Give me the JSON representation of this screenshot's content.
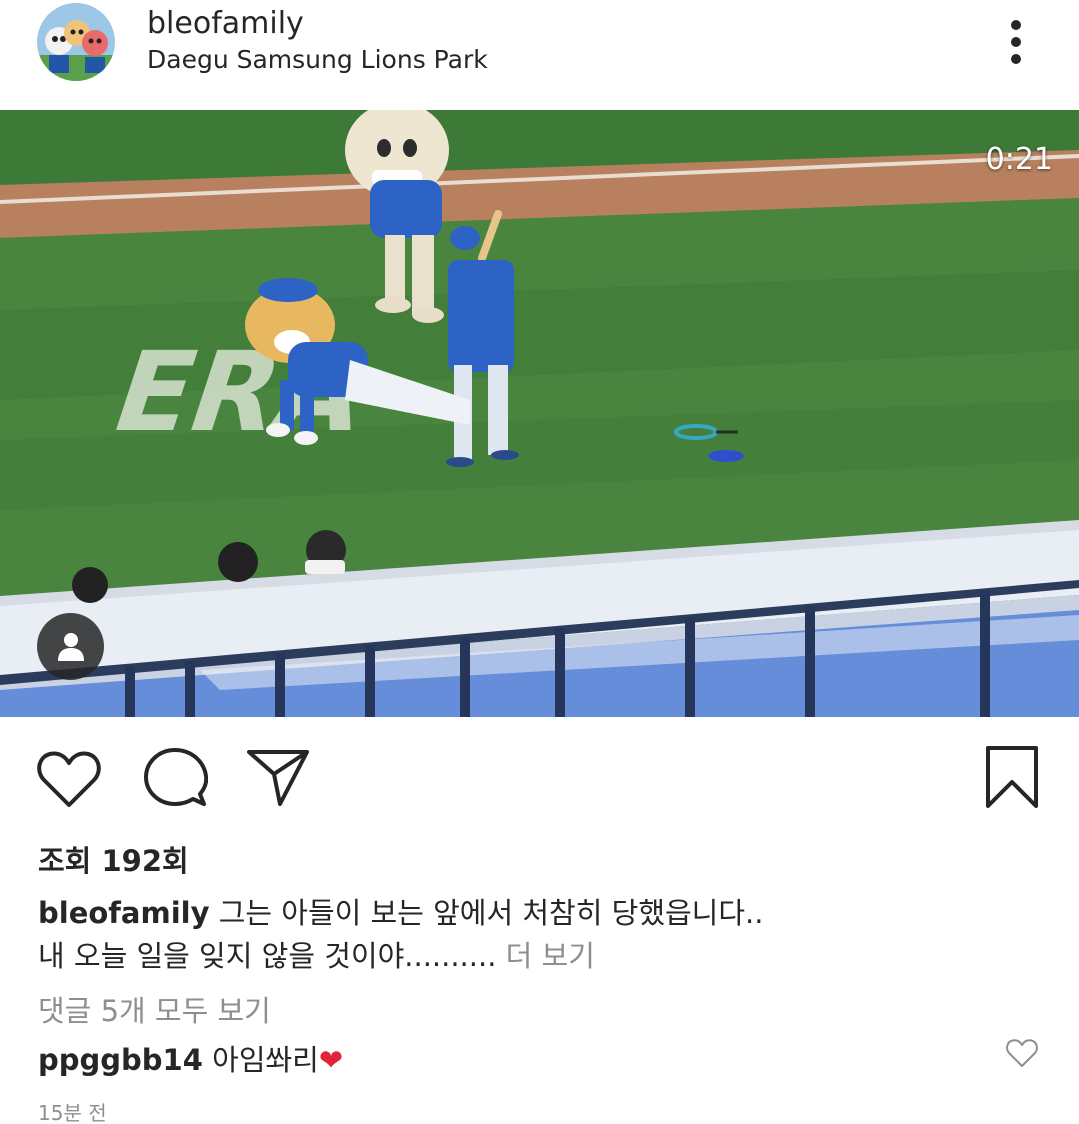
{
  "header": {
    "username": "bleofamily",
    "location": "Daegu Samsung Lions Park",
    "more_icon": "more-vertical-icon"
  },
  "video": {
    "timer": "0:21",
    "tag_icon": "person-icon",
    "field_text": "ERA"
  },
  "actions": {
    "like_icon": "heart-icon",
    "comment_icon": "comment-icon",
    "share_icon": "paper-plane-icon",
    "save_icon": "bookmark-icon"
  },
  "post": {
    "views": "조회 192회",
    "caption_user": "bleofamily",
    "caption_line1": "그는 아들이 보는 앞에서 처참히 당했읍니다..",
    "caption_line2": "내 오늘 일을 잊지 않을 것이야..........",
    "more_label": "더 보기",
    "view_comments": "댓글 5개 모두 보기",
    "comment_user": "ppggbb14",
    "comment_text": "아임쏴리",
    "comment_emoji": "❤",
    "timestamp": "15분 전"
  },
  "colors": {
    "text": "#262626",
    "muted": "#8e8e8e",
    "heart_red": "#e0243a",
    "field_green": "#3f7a3a",
    "team_blue": "#1f5fbf"
  }
}
